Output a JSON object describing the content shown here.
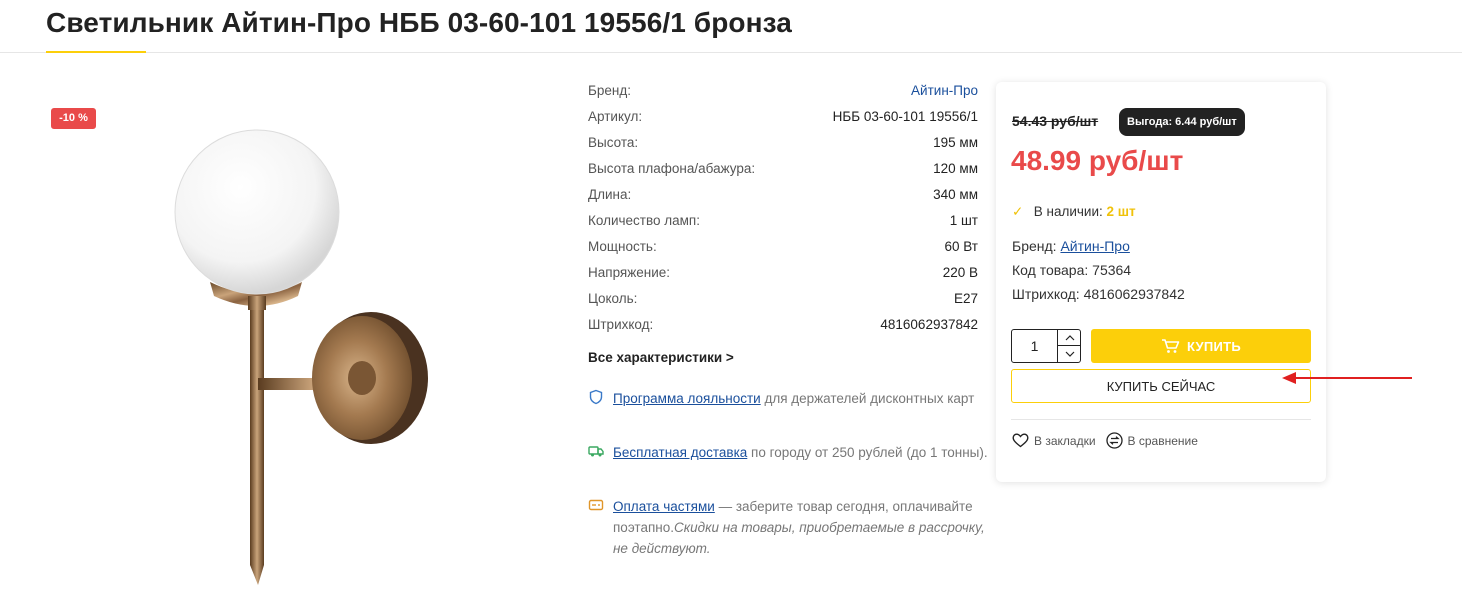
{
  "product": {
    "title": "Светильник Айтин-Про НББ 03-60-101 19556/1 бронза",
    "discount_badge": "-10 %"
  },
  "specs": [
    {
      "name": "Бренд:",
      "value": "Айтин-Про",
      "is_link": true
    },
    {
      "name": "Артикул:",
      "value": "НББ 03-60-101 19556/1"
    },
    {
      "name": "Высота:",
      "value": "195 мм"
    },
    {
      "name": "Высота плафона/абажура:",
      "value": "120 мм"
    },
    {
      "name": "Длина:",
      "value": "340 мм"
    },
    {
      "name": "Количество ламп:",
      "value": "1 шт"
    },
    {
      "name": "Мощность:",
      "value": "60 Вт"
    },
    {
      "name": "Напряжение:",
      "value": "220 В"
    },
    {
      "name": "Цоколь:",
      "value": "E27"
    },
    {
      "name": "Штрихкод:",
      "value": "4816062937842"
    }
  ],
  "all_specs_link": "Все характеристики >",
  "perks": {
    "loyalty": {
      "link": "Программа лояльности",
      "text": " для держателей дисконтных карт",
      "icon": "shield-icon"
    },
    "delivery": {
      "link": "Бесплатная доставка",
      "text": " по городу от 250 рублей (до 1 тонны).",
      "icon": "truck-icon"
    },
    "installment": {
      "link": "Оплата частями",
      "text": " — заберите товар сегодня, оплачивайте поэтапно.",
      "italic": "Скидки на товары, приобретаемые в рассрочку, не действуют.",
      "icon": "card-icon"
    }
  },
  "buy_card": {
    "old_price": "54.43 руб/шт",
    "benefit": "Выгода: 6.44 руб/шт",
    "price": "48.99 руб/шт",
    "stock_label": "В наличии:",
    "stock_qty": "2 шт",
    "brand_label": "Бренд:",
    "brand_value": "Айтин-Про",
    "code_label": "Код товара:",
    "code_value": "75364",
    "barcode_label": "Штрихкод:",
    "barcode_value": "4816062937842",
    "quantity": "1",
    "buy_label": "КУПИТЬ",
    "buy_now_label": "КУПИТЬ СЕЙЧАС",
    "bookmark_label": "В закладки",
    "compare_label": "В сравнение"
  },
  "colors": {
    "accent_yellow": "#fccf0a",
    "price_red": "#e94a4a",
    "link_blue": "#1a4f9c",
    "annotation_arrow": "#e02020"
  }
}
